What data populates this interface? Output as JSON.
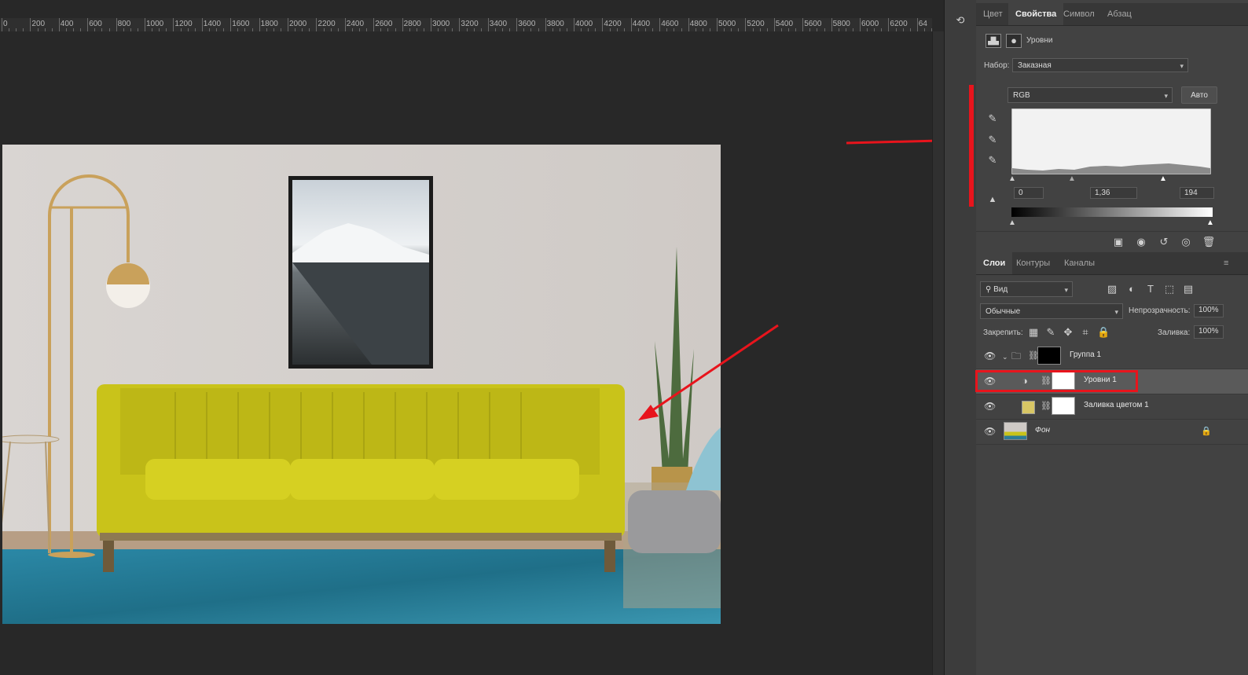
{
  "ruler": {
    "labels": [
      "0",
      "200",
      "400",
      "600",
      "800",
      "1000",
      "1200",
      "1400",
      "1600",
      "1800",
      "2000",
      "2200",
      "2400",
      "2600",
      "2800",
      "3000",
      "3200",
      "3400",
      "3600",
      "3800",
      "4000",
      "4200",
      "4400",
      "4600",
      "4800",
      "5000",
      "5200",
      "5400",
      "5600",
      "5800",
      "6000",
      "6200",
      "64"
    ]
  },
  "properties_tabs": [
    "Цвет",
    "Свойства",
    "Символ",
    "Абзац"
  ],
  "properties": {
    "layer_type": "Уровни",
    "preset_label": "Набор:",
    "preset_value": "Заказная",
    "channel_value": "RGB",
    "auto_button": "Авто",
    "input_black": "0",
    "input_gamma": "1,36",
    "input_white": "194"
  },
  "layers_tabs": [
    "Слои",
    "Контуры",
    "Каналы"
  ],
  "layers": {
    "filter_kind": "Вид",
    "blend_mode": "Обычные",
    "opacity_label": "Непрозрачность:",
    "opacity_value": "100%",
    "lock_label": "Закрепить:",
    "fill_label": "Заливка:",
    "fill_value": "100%",
    "items": [
      {
        "name": "Группа 1"
      },
      {
        "name": "Уровни 1"
      },
      {
        "name": "Заливка цветом 1"
      },
      {
        "name": "Фон"
      }
    ]
  },
  "colors": {
    "highlight": "#e8141c",
    "fill_swatch": "#d8c665",
    "sofa": "#c9c31a",
    "rug": "#2d7c96"
  }
}
